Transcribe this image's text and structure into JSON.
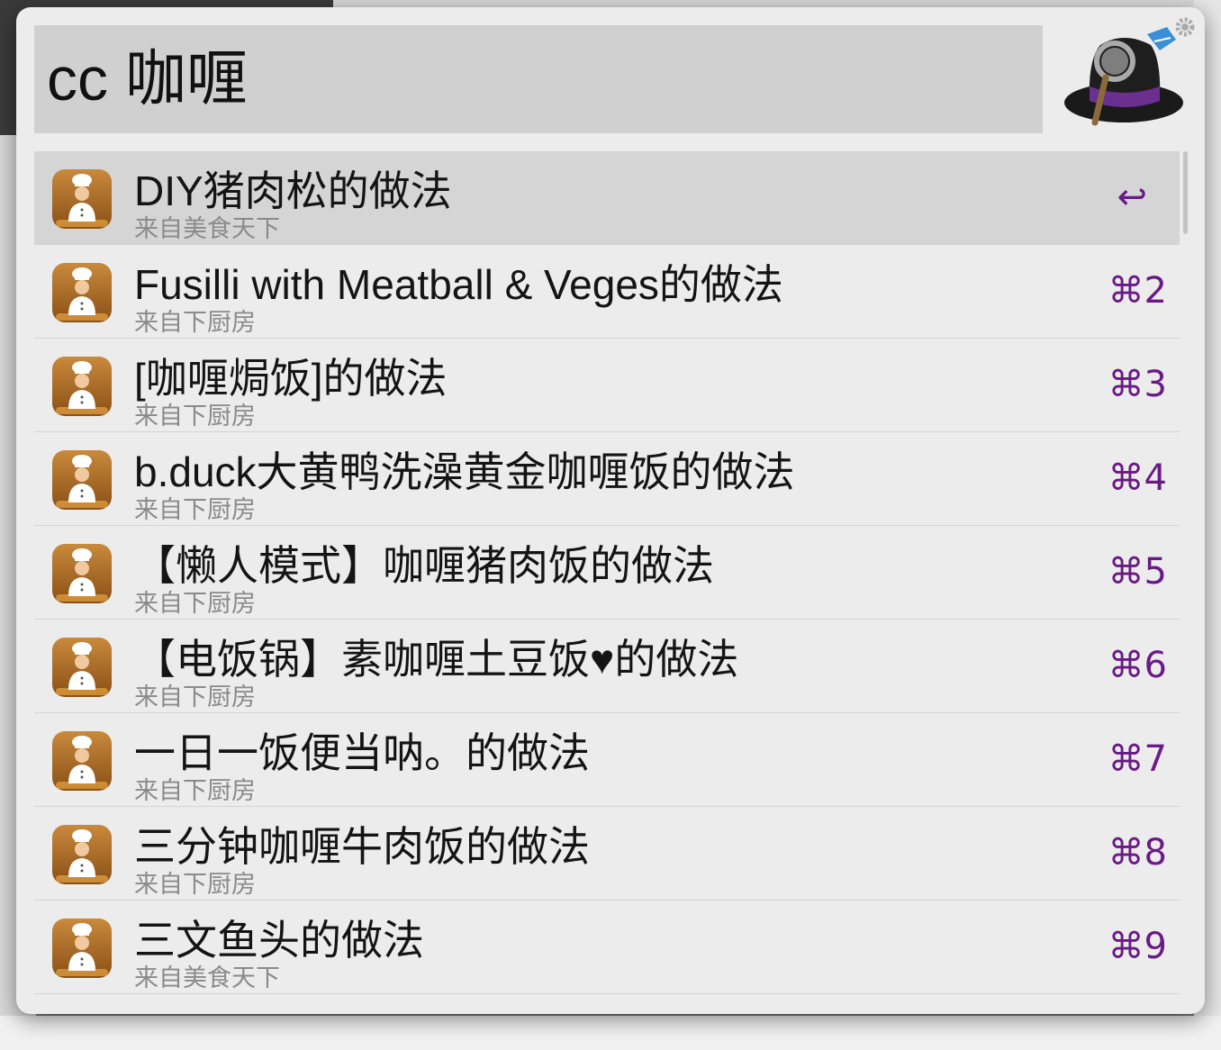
{
  "search": {
    "query": "cc 咖喱"
  },
  "results": [
    {
      "title": "DIY猪肉松的做法",
      "subtitle": "来自美食天下",
      "shortcut": "↩",
      "selected": true
    },
    {
      "title": "Fusilli with Meatball & Veges的做法",
      "subtitle": "来自下厨房",
      "shortcut": "⌘2"
    },
    {
      "title": "[咖喱焗饭]的做法",
      "subtitle": "来自下厨房",
      "shortcut": "⌘3"
    },
    {
      "title": "b.duck大黄鸭洗澡黄金咖喱饭的做法",
      "subtitle": "来自下厨房",
      "shortcut": "⌘4"
    },
    {
      "title": "【懒人模式】咖喱猪肉饭的做法",
      "subtitle": "来自下厨房",
      "shortcut": "⌘5"
    },
    {
      "title": "【电饭锅】素咖喱土豆饭♥的做法",
      "subtitle": "来自下厨房",
      "shortcut": "⌘6"
    },
    {
      "title": "一日一饭便当呐。的做法",
      "subtitle": "来自下厨房",
      "shortcut": "⌘7"
    },
    {
      "title": "三分钟咖喱牛肉饭的做法",
      "subtitle": "来自下厨房",
      "shortcut": "⌘8"
    },
    {
      "title": "三文鱼头的做法",
      "subtitle": "来自美食天下",
      "shortcut": "⌘9"
    }
  ],
  "icons": {
    "result": "chef-icon",
    "app": "alfred-hat-icon",
    "settings": "gear-icon"
  },
  "colors": {
    "shortcut": "#6a1a86",
    "selected_row": "#d5d5d5",
    "window": "#ececec"
  }
}
